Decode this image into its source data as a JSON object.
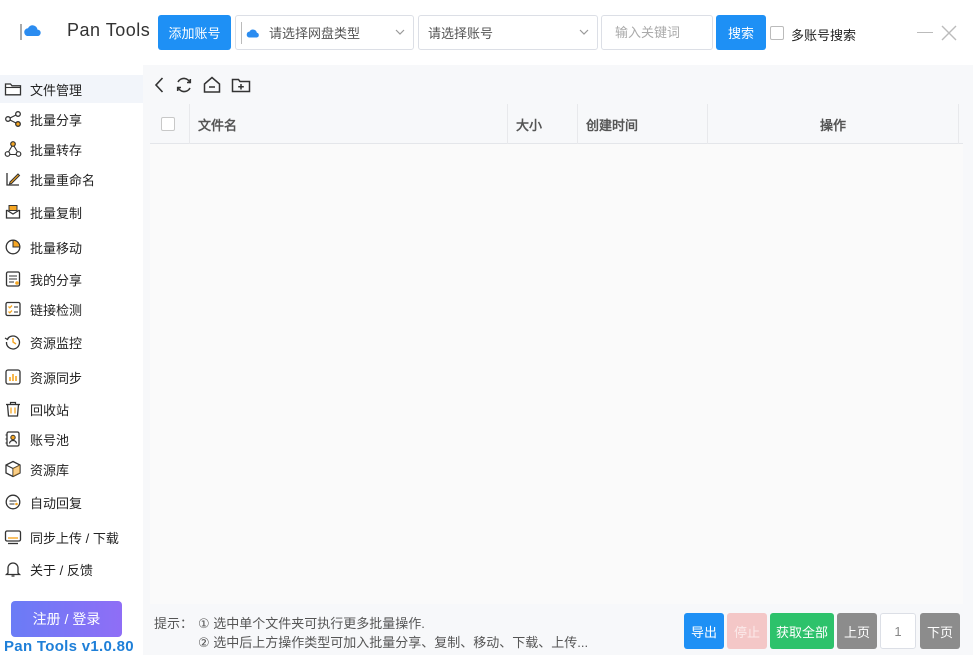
{
  "app": {
    "title": "Pan Tools",
    "version": "Pan Tools v1.0.80"
  },
  "topbar": {
    "add_account_label": "添加账号",
    "disk_type_select": {
      "value": "请选择网盘类型",
      "icon": "cloud-icon"
    },
    "account_select": {
      "value": "请选择账号"
    },
    "search": {
      "placeholder": "输入关键词",
      "button_label": "搜索"
    },
    "multi_account_search": {
      "label": "多账号搜索",
      "checked": false
    }
  },
  "sidebar": {
    "items": [
      {
        "label": "文件管理",
        "icon": "folder-icon",
        "active": true
      },
      {
        "label": "批量分享",
        "icon": "share-icon"
      },
      {
        "label": "批量转存",
        "icon": "transfer-icon"
      },
      {
        "label": "批量重命名",
        "icon": "rename-icon"
      },
      {
        "label": "批量复制",
        "icon": "copy-icon"
      },
      {
        "label": "批量移动",
        "icon": "move-icon"
      },
      {
        "label": "我的分享",
        "icon": "my-share-icon"
      },
      {
        "label": "链接检测",
        "icon": "link-check-icon"
      },
      {
        "label": "资源监控",
        "icon": "monitor-icon"
      },
      {
        "label": "资源同步",
        "icon": "sync-icon"
      },
      {
        "label": "回收站",
        "icon": "trash-icon"
      },
      {
        "label": "账号池",
        "icon": "account-pool-icon"
      },
      {
        "label": "资源库",
        "icon": "library-icon"
      },
      {
        "label": "自动回复",
        "icon": "auto-reply-icon"
      },
      {
        "label": "同步上传 / 下载",
        "icon": "upload-download-icon"
      },
      {
        "label": "关于 / 反馈",
        "icon": "bell-icon"
      }
    ],
    "login_label": "注册 / 登录"
  },
  "toolbar": {
    "icons": [
      "back-icon",
      "refresh-icon",
      "home-icon",
      "new-folder-icon"
    ]
  },
  "table": {
    "columns": [
      "文件名",
      "大小",
      "创建时间",
      "操作"
    ],
    "rows": []
  },
  "tips": {
    "label": "提示：",
    "lines": [
      "① 选中单个文件夹可执行更多批量操作.",
      "② 选中后上方操作类型可加入批量分享、复制、移动、下载、上传..."
    ]
  },
  "pagination": {
    "export_label": "导出",
    "stop_label": "停止",
    "fetch_all_label": "获取全部",
    "prev_label": "上页",
    "page": "1",
    "next_label": "下页"
  },
  "colors": {
    "primary": "#1e90f5",
    "success": "#2dc26b",
    "stop_disabled": "#f4c7c7",
    "gray": "#8c8c8c",
    "version": "#1e7fd8"
  }
}
